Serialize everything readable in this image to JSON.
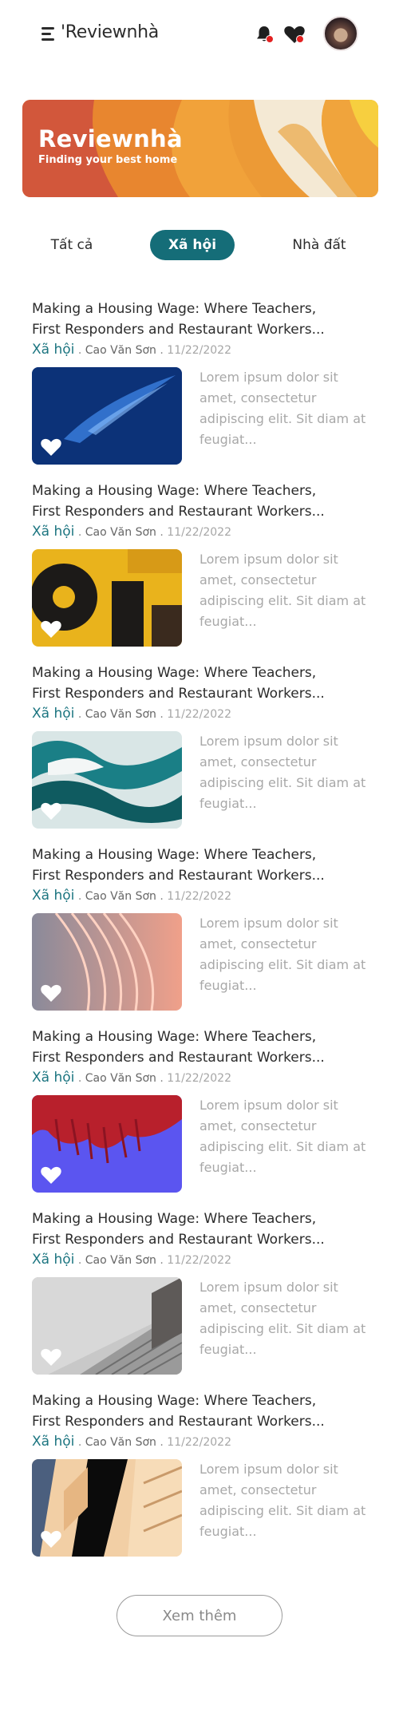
{
  "header": {
    "logo": "'Reviewnhà"
  },
  "banner": {
    "title": "Reviewnhà",
    "subtitle": "Finding your best home"
  },
  "tabs": [
    {
      "label": "Tất cả"
    },
    {
      "label": "Xã hội"
    },
    {
      "label": "Nhà đất"
    }
  ],
  "articles": [
    {
      "title_line1": "Making a Housing Wage: Where Teachers,",
      "title_line2": "First Responders and Restaurant Workers...",
      "category": "Xã hội",
      "author": "Cao Văn Sơn",
      "date": "11/22/2022",
      "excerpt": "Lorem ipsum dolor sit amet, consectetur adipiscing elit. Sit diam at feugiat..."
    },
    {
      "title_line1": "Making a Housing Wage: Where Teachers,",
      "title_line2": "First Responders and Restaurant Workers...",
      "category": "Xã hội",
      "author": "Cao Văn Sơn",
      "date": "11/22/2022",
      "excerpt": "Lorem ipsum dolor sit amet, consectetur adipiscing elit. Sit diam at feugiat..."
    },
    {
      "title_line1": "Making a Housing Wage: Where Teachers,",
      "title_line2": "First Responders and Restaurant Workers...",
      "category": "Xã hội",
      "author": "Cao Văn Sơn",
      "date": "11/22/2022",
      "excerpt": "Lorem ipsum dolor sit amet, consectetur adipiscing elit. Sit diam at feugiat..."
    },
    {
      "title_line1": "Making a Housing Wage: Where Teachers,",
      "title_line2": "First Responders and Restaurant Workers...",
      "category": "Xã hội",
      "author": "Cao Văn Sơn",
      "date": "11/22/2022",
      "excerpt": "Lorem ipsum dolor sit amet, consectetur adipiscing elit. Sit diam at feugiat..."
    },
    {
      "title_line1": "Making a Housing Wage: Where Teachers,",
      "title_line2": "First Responders and Restaurant Workers...",
      "category": "Xã hội",
      "author": "Cao Văn Sơn",
      "date": "11/22/2022",
      "excerpt": "Lorem ipsum dolor sit amet, consectetur adipiscing elit. Sit diam at feugiat..."
    },
    {
      "title_line1": "Making a Housing Wage: Where Teachers,",
      "title_line2": "First Responders and Restaurant Workers...",
      "category": "Xã hội",
      "author": "Cao Văn Sơn",
      "date": "11/22/2022",
      "excerpt": "Lorem ipsum dolor sit amet, consectetur adipiscing elit. Sit diam at feugiat..."
    },
    {
      "title_line1": "Making a Housing Wage: Where Teachers,",
      "title_line2": "First Responders and Restaurant Workers...",
      "category": "Xã hội",
      "author": "Cao Văn Sơn",
      "date": "11/22/2022",
      "excerpt": "Lorem ipsum dolor sit amet, consectetur adipiscing elit. Sit diam at feugiat..."
    }
  ],
  "load_more": {
    "label": "Xem thêm"
  },
  "colors": {
    "accent": "#156d78",
    "notification_dot": "#e32121"
  }
}
